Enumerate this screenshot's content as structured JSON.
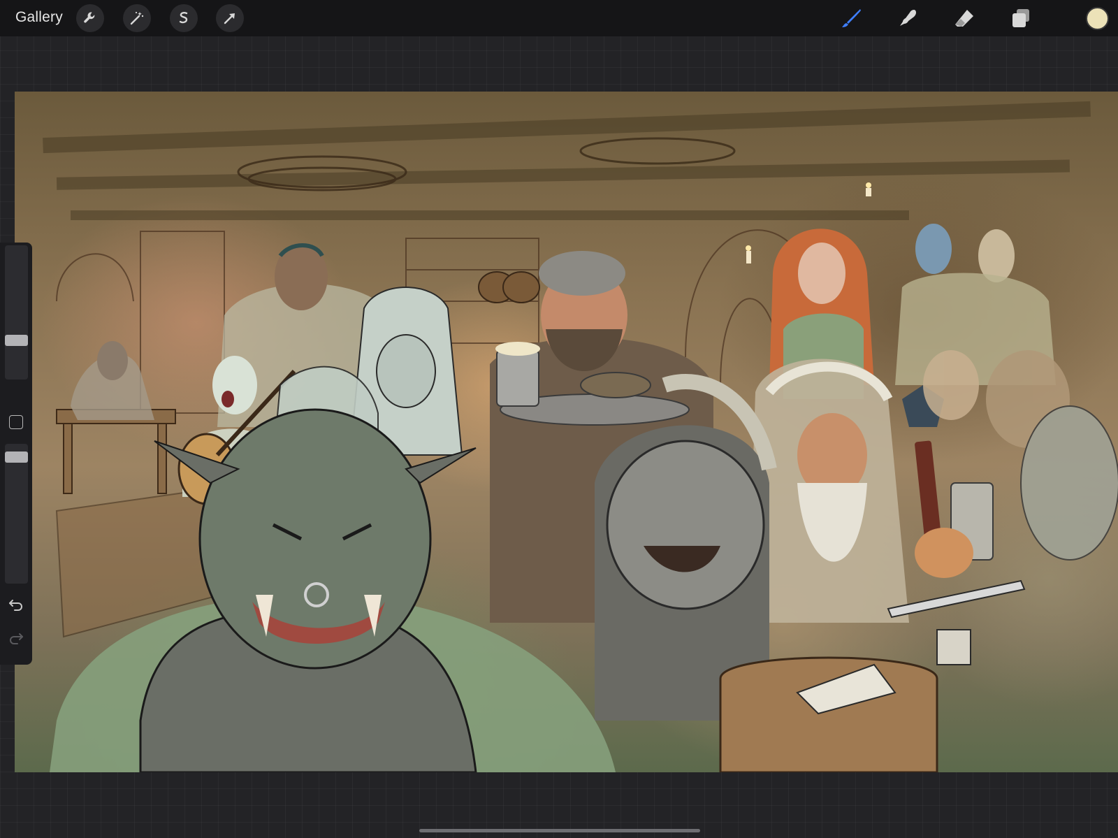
{
  "topbar": {
    "gallery_label": "Gallery",
    "left_tools": [
      "wrench-icon",
      "magic-wand-icon",
      "selection-icon",
      "transform-arrow-icon"
    ],
    "right_tools": [
      "brush-icon",
      "smudge-icon",
      "eraser-icon",
      "layers-icon"
    ],
    "active_tool": "brush",
    "active_tool_color": "#3f7fff",
    "current_color": "#ece2b8"
  },
  "sidebar": {
    "brush_size_level": 0.27,
    "opacity_level": 0.94,
    "undo_icon": "undo-icon",
    "redo_icon": "redo-icon",
    "modify_icon": "square-icon"
  },
  "canvas": {
    "artwork": "fantasy-tavern-painting"
  }
}
